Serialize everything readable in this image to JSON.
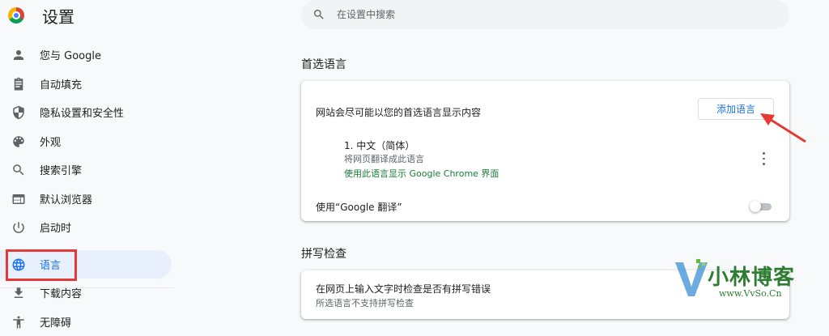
{
  "app": {
    "title": "设置"
  },
  "search": {
    "placeholder": "在设置中搜索"
  },
  "sidebar": {
    "items": [
      {
        "label": "您与 Google",
        "icon": "person-icon"
      },
      {
        "label": "自动填充",
        "icon": "clipboard-icon"
      },
      {
        "label": "隐私设置和安全性",
        "icon": "shield-icon"
      },
      {
        "label": "外观",
        "icon": "palette-icon"
      },
      {
        "label": "搜索引擎",
        "icon": "search-icon"
      },
      {
        "label": "默认浏览器",
        "icon": "browser-icon"
      },
      {
        "label": "启动时",
        "icon": "power-icon"
      },
      {
        "label": "语言",
        "icon": "globe-icon",
        "active": true
      },
      {
        "label": "下载内容",
        "icon": "download-icon"
      },
      {
        "label": "无障碍",
        "icon": "accessibility-icon"
      }
    ]
  },
  "languages": {
    "section_title": "首选语言",
    "description": "网站会尽可能以您的首选语言显示内容",
    "add_button": "添加语言",
    "entry": {
      "name": "1. 中文（简体）",
      "subtitle": "将网页翻译成此语言",
      "ui_note": "使用此语言显示 Google Chrome 界面"
    },
    "translate_label": "使用“Google 翻译”",
    "translate_enabled": false
  },
  "spellcheck": {
    "section_title": "拼写检查",
    "title": "在网页上输入文字时检查是否有拼写错误",
    "subtitle": "所选语言不支持拼写检查"
  },
  "watermark": {
    "text": "小林博客",
    "url": "www.VvSo.Cn"
  },
  "colors": {
    "accent": "#1a73e8",
    "active_bg": "#e8f0fe",
    "highlight": "#e53935",
    "link_green": "#188038"
  }
}
